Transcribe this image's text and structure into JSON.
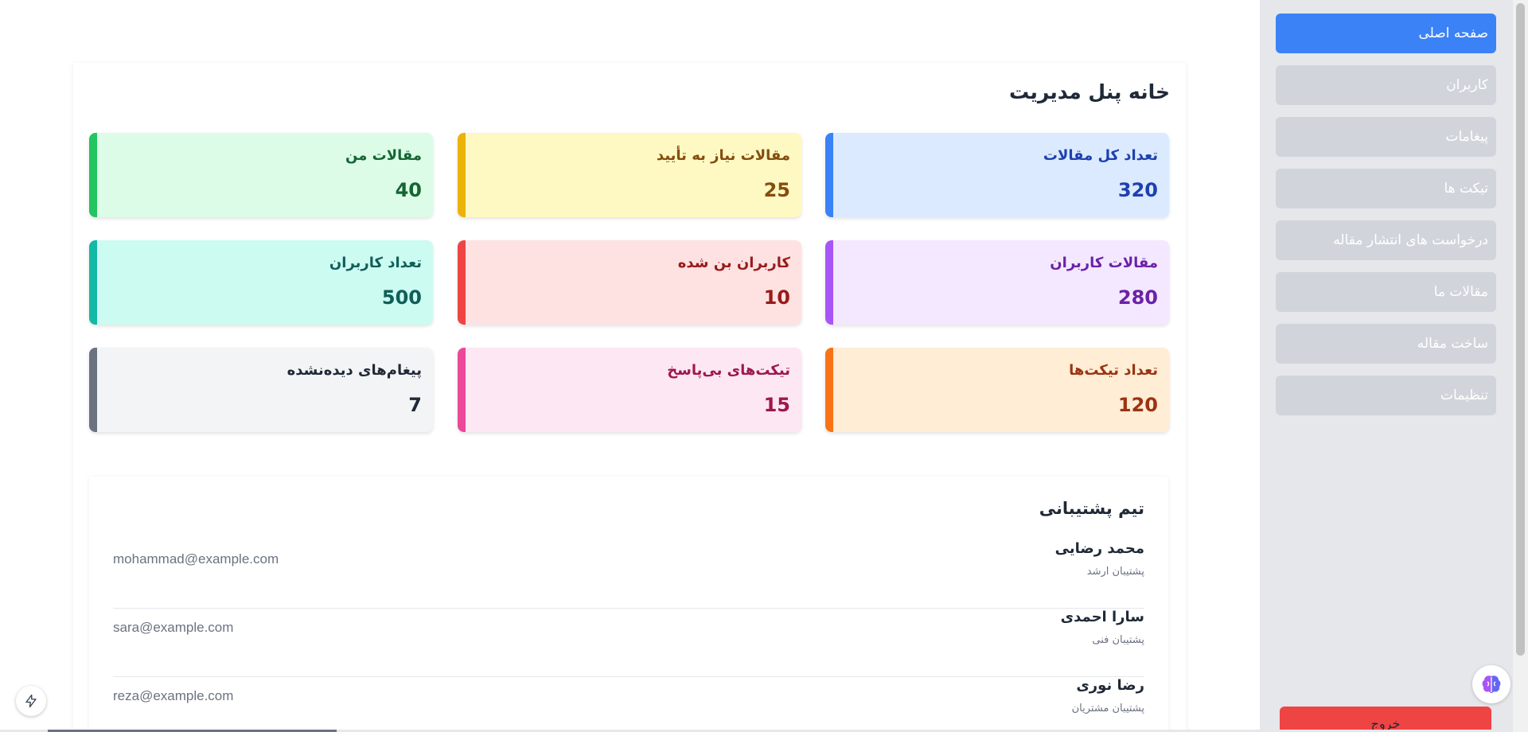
{
  "sidebar": {
    "items": [
      {
        "label": "صفحه اصلی",
        "active": true
      },
      {
        "label": "کاربران"
      },
      {
        "label": "پیغامات"
      },
      {
        "label": "تیکت ها"
      },
      {
        "label": "درخواست های انتشار مقاله"
      },
      {
        "label": "مقالات ما"
      },
      {
        "label": "ساخت مقاله"
      },
      {
        "label": "تنظیمات"
      }
    ],
    "logout_label": "خروج"
  },
  "main": {
    "title": "خانه پنل مدیریت",
    "cards": [
      {
        "label": "تعداد کل مقالات",
        "value": "320",
        "bg": "#dbeafe",
        "accent": "#3b82f6",
        "text": "#1e40af"
      },
      {
        "label": "مقالات نیاز به تأیید",
        "value": "25",
        "bg": "#fef9c3",
        "accent": "#eab308",
        "text": "#854d0e"
      },
      {
        "label": "مقالات من",
        "value": "40",
        "bg": "#dcfce7",
        "accent": "#22c55e",
        "text": "#166534"
      },
      {
        "label": "مقالات کاربران",
        "value": "280",
        "bg": "#f3e8ff",
        "accent": "#a855f7",
        "text": "#6b21a8"
      },
      {
        "label": "کاربران بن شده",
        "value": "10",
        "bg": "#fee2e2",
        "accent": "#ef4444",
        "text": "#991b1b"
      },
      {
        "label": "تعداد کاربران",
        "value": "500",
        "bg": "#ccfbf1",
        "accent": "#14b8a6",
        "text": "#115e59"
      },
      {
        "label": "تعداد تیکت‌ها",
        "value": "120",
        "bg": "#ffedd5",
        "accent": "#f97316",
        "text": "#9a3412"
      },
      {
        "label": "تیکت‌های بی‌پاسخ",
        "value": "15",
        "bg": "#fce7f3",
        "accent": "#ec4899",
        "text": "#9d174d"
      },
      {
        "label": "پیغام‌های دیده‌نشده",
        "value": "7",
        "bg": "#f3f4f6",
        "accent": "#6b7280",
        "text": "#1f2937"
      }
    ],
    "team": {
      "title": "تیم پشتیبانی",
      "members": [
        {
          "name": "محمد رضایی",
          "role": "پشتیبان ارشد",
          "email": "mohammad@example.com"
        },
        {
          "name": "سارا احمدی",
          "role": "پشتیبان فنی",
          "email": "sara@example.com"
        },
        {
          "name": "رضا نوری",
          "role": "پشتیبان مشتریان",
          "email": "reza@example.com"
        }
      ]
    }
  },
  "floating": {
    "bolt_icon": "bolt-icon",
    "brain_icon": "brain-icon"
  }
}
